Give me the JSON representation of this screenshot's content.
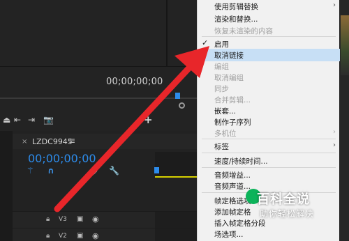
{
  "monitor": {
    "timecode": "00;00;00;00",
    "controls": [
      "⏏",
      "⇤",
      "⇥",
      "📷"
    ],
    "add_icon": "+"
  },
  "timeline": {
    "close": "×",
    "sequence_name": "LZDC9945",
    "menu_icon": "≡",
    "timecode": "00;00;00;00",
    "tools": [
      "⚚",
      "∩",
      "◆",
      "🔧"
    ],
    "tracks": [
      {
        "name": "V3"
      },
      {
        "name": "V2"
      }
    ]
  },
  "context_menu": {
    "items": [
      {
        "label": "使用剪辑替换",
        "disabled": false,
        "submenu": true
      },
      {
        "label": "渲染和替换...",
        "disabled": false
      },
      {
        "label": "恢复未渲染的内容",
        "disabled": true
      },
      {
        "label": "启用",
        "disabled": false,
        "checked": true
      },
      {
        "label": "取消链接",
        "disabled": false,
        "highlighted": true
      },
      {
        "label": "编组",
        "disabled": true
      },
      {
        "label": "取消编组",
        "disabled": true
      },
      {
        "label": "同步",
        "disabled": true
      },
      {
        "label": "合并剪辑...",
        "disabled": true
      },
      {
        "label": "嵌套...",
        "disabled": false
      },
      {
        "label": "制作子序列",
        "disabled": false
      },
      {
        "label": "多机位",
        "disabled": true,
        "submenu": true
      },
      {
        "label": "标签",
        "disabled": false,
        "submenu": true
      },
      {
        "label": "速度/持续时间...",
        "disabled": false
      },
      {
        "label": "音频增益...",
        "disabled": false
      },
      {
        "label": "音频声道...",
        "disabled": false
      },
      {
        "label": "帧定格选项...",
        "disabled": false
      },
      {
        "label": "添加帧定格",
        "disabled": false
      },
      {
        "label": "插入帧定格分段",
        "disabled": false
      },
      {
        "label": "场选项...",
        "disabled": false
      }
    ],
    "checkmark": "✓",
    "submenu_arrow": "›",
    "highlight_color": "#c7dff5"
  },
  "watermark": {
    "title": "百科全说",
    "subtitle": "助你轻松解决"
  },
  "colors": {
    "accent_blue": "#2d8ceb",
    "arrow_red": "#e8262a",
    "playhead_yellow": "#d6d000"
  }
}
